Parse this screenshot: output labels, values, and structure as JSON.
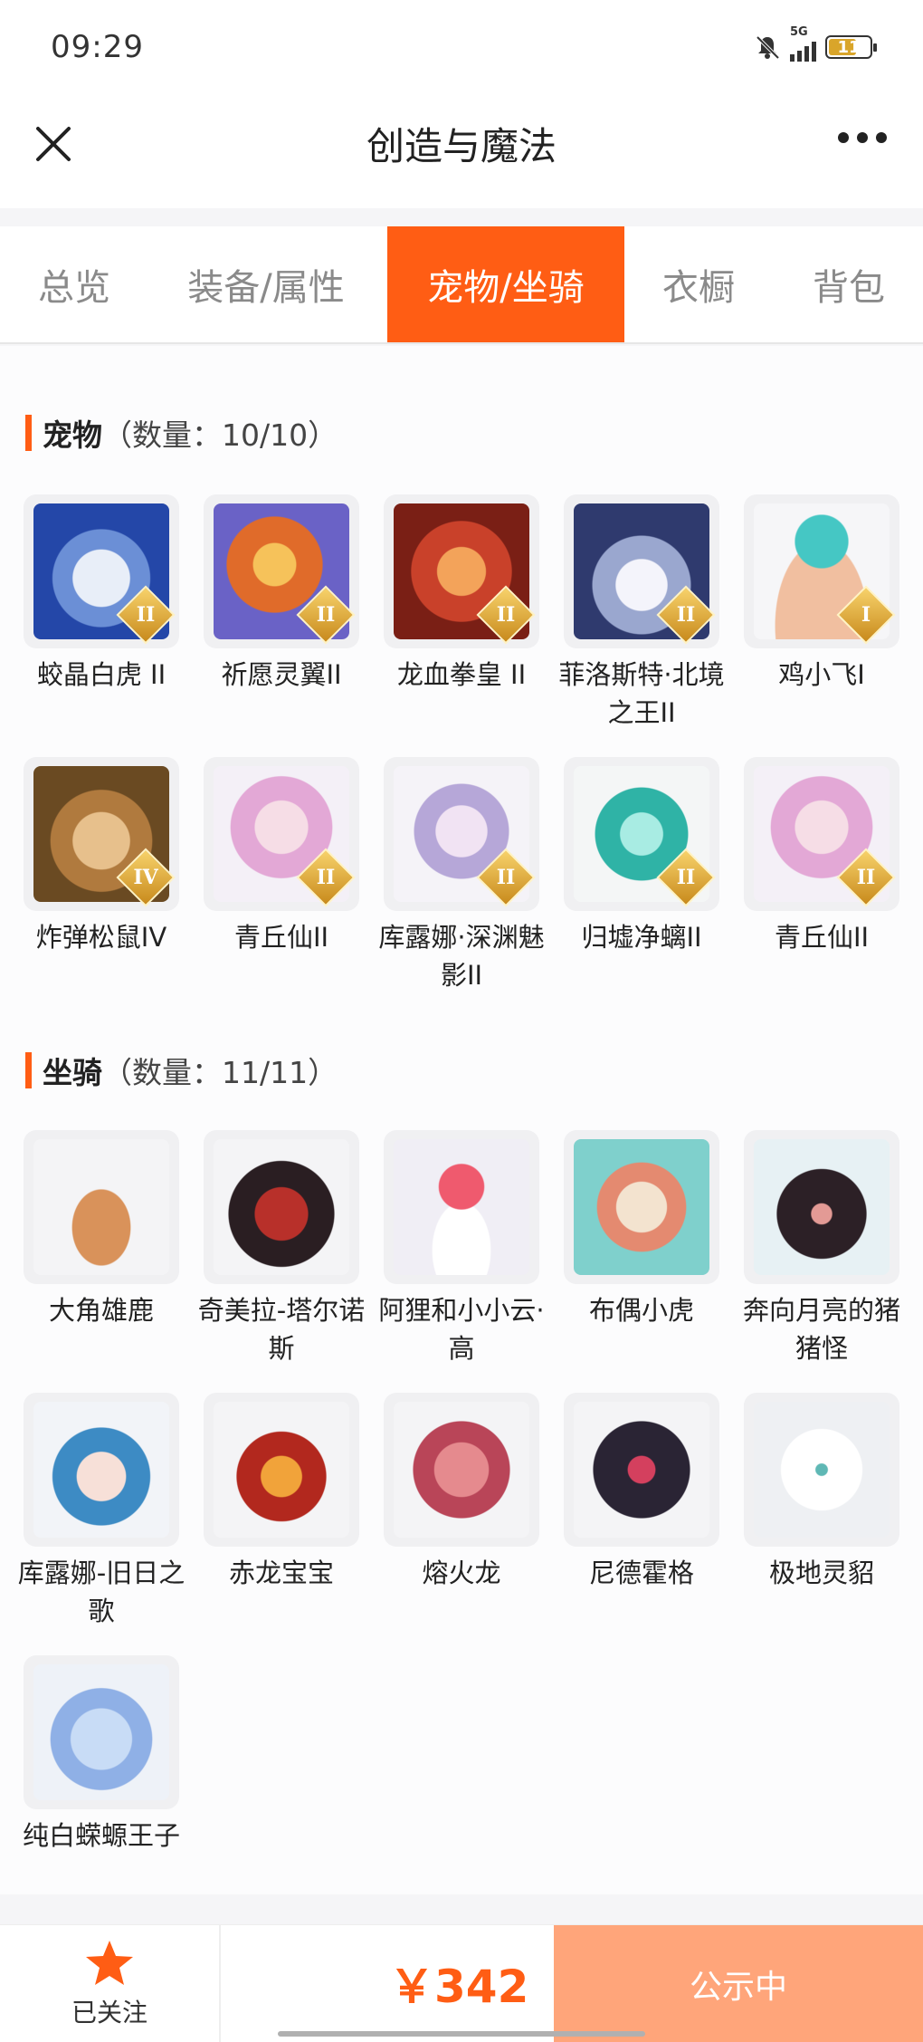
{
  "statusbar": {
    "time": "09:29",
    "network": "5G",
    "battery": "11"
  },
  "header": {
    "title": "创造与魔法"
  },
  "tabs": [
    {
      "label": "总览",
      "active": false
    },
    {
      "label": "装备/属性",
      "active": false
    },
    {
      "label": "宠物/坐骑",
      "active": true
    },
    {
      "label": "衣橱",
      "active": false
    },
    {
      "label": "背包",
      "active": false
    }
  ],
  "pets": {
    "title": "宠物",
    "count": "（数量：10/10）",
    "items": [
      {
        "label": "蛟晶白虎 II",
        "badge": "II"
      },
      {
        "label": "祈愿灵翼II",
        "badge": "II"
      },
      {
        "label": "龙血拳皇 II",
        "badge": "II"
      },
      {
        "label": "菲洛斯特·北境之王II",
        "badge": "II"
      },
      {
        "label": "鸡小飞I",
        "badge": "I"
      },
      {
        "label": "炸弹松鼠IV",
        "badge": "IV"
      },
      {
        "label": "青丘仙II",
        "badge": "II"
      },
      {
        "label": "库露娜·深渊魅影II",
        "badge": "II"
      },
      {
        "label": "归墟净螭II",
        "badge": "II"
      },
      {
        "label": "青丘仙II",
        "badge": "II"
      }
    ]
  },
  "mounts": {
    "title": "坐骑",
    "count": "（数量：11/11）",
    "items": [
      {
        "label": "大角雄鹿"
      },
      {
        "label": "奇美拉-塔尔诺斯"
      },
      {
        "label": "阿狸和小小云·高"
      },
      {
        "label": "布偶小虎"
      },
      {
        "label": "奔向月亮的猪猪怪"
      },
      {
        "label": "库露娜-旧日之歌"
      },
      {
        "label": "赤龙宝宝"
      },
      {
        "label": "熔火龙"
      },
      {
        "label": "尼德霍格"
      },
      {
        "label": "极地灵貂"
      },
      {
        "label": "纯白蝾螈王子"
      }
    ]
  },
  "bottom": {
    "follow_label": "已关注",
    "price": "￥342",
    "status_label": "公示中"
  }
}
